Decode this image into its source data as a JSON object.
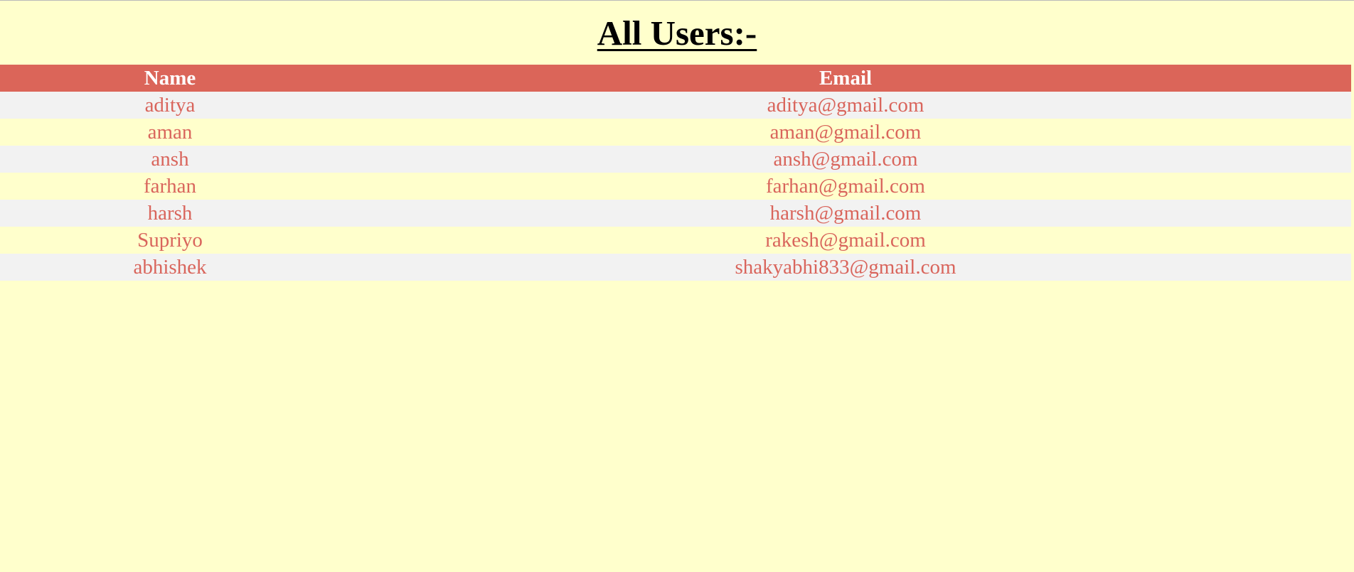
{
  "page": {
    "title": "All Users:-"
  },
  "table": {
    "headers": {
      "name": "Name",
      "email": "Email"
    },
    "rows": [
      {
        "name": "aditya",
        "email": "aditya@gmail.com"
      },
      {
        "name": "aman",
        "email": "aman@gmail.com"
      },
      {
        "name": "ansh",
        "email": "ansh@gmail.com"
      },
      {
        "name": "farhan",
        "email": "farhan@gmail.com"
      },
      {
        "name": "harsh",
        "email": "harsh@gmail.com"
      },
      {
        "name": "Supriyo",
        "email": "rakesh@gmail.com"
      },
      {
        "name": "abhishek",
        "email": "shakyabhi833@gmail.com"
      }
    ]
  },
  "colors": {
    "page_background": "#ffffcc",
    "header_background": "#db6559",
    "header_text": "#ffffff",
    "row_text": "#d9655c",
    "stripe_background": "#f2f2f2"
  }
}
